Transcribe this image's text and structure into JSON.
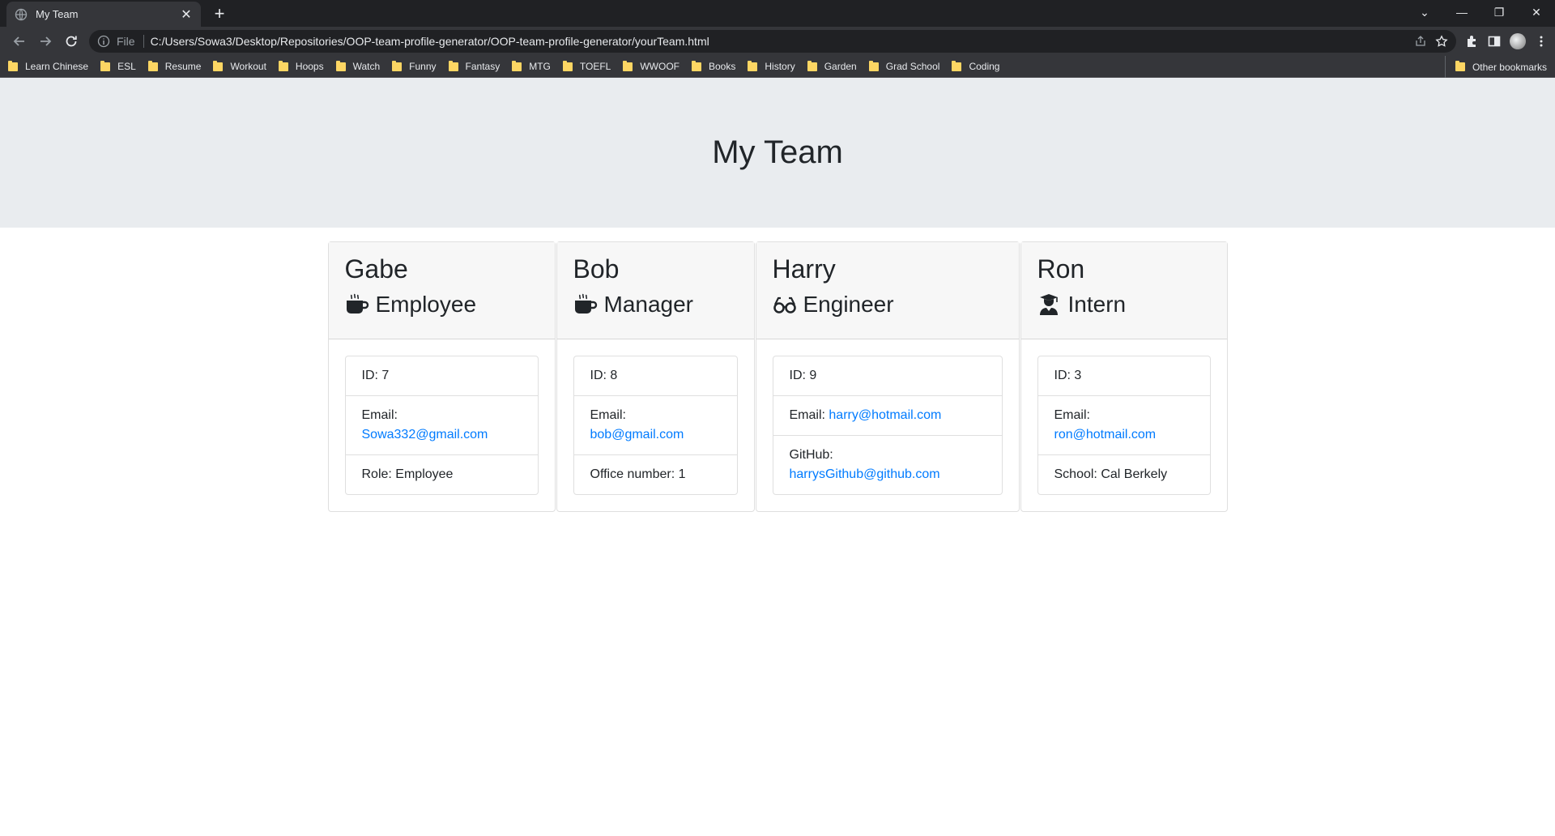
{
  "browser": {
    "tab_title": "My Team",
    "url_scheme": "File",
    "url": "C:/Users/Sowa3/Desktop/Repositories/OOP-team-profile-generator/OOP-team-profile-generator/yourTeam.html",
    "bookmarks": [
      "Learn Chinese",
      "ESL",
      "Resume",
      "Workout",
      "Hoops",
      "Watch",
      "Funny",
      "Fantasy",
      "MTG",
      "TOEFL",
      "WWOOF",
      "Books",
      "History",
      "Garden",
      "Grad School",
      "Coding"
    ],
    "other_bookmarks": "Other bookmarks"
  },
  "page": {
    "title": "My Team",
    "cards": [
      {
        "name": "Gabe",
        "role": "Employee",
        "icon": "mug-icon",
        "id_text": "ID: 7",
        "email_label": "Email: ",
        "email": "Sowa332@gmail.com",
        "extra_label": "Role: Employee",
        "extra_link": ""
      },
      {
        "name": "Bob",
        "role": "Manager",
        "icon": "mug-icon",
        "id_text": "ID: 8",
        "email_label": "Email: ",
        "email": "bob@gmail.com",
        "extra_label": "Office number: 1",
        "extra_link": ""
      },
      {
        "name": "Harry",
        "role": "Engineer",
        "icon": "glasses-icon",
        "id_text": "ID: 9",
        "email_label": "Email: ",
        "email": "harry@hotmail.com",
        "extra_label": "GitHub: ",
        "extra_link": "harrysGithub@github.com"
      },
      {
        "name": "Ron",
        "role": "Intern",
        "icon": "graduate-icon",
        "id_text": "ID: 3",
        "email_label": "Email: ",
        "email": "ron@hotmail.com",
        "extra_label": "School: Cal Berkely",
        "extra_link": ""
      }
    ]
  }
}
